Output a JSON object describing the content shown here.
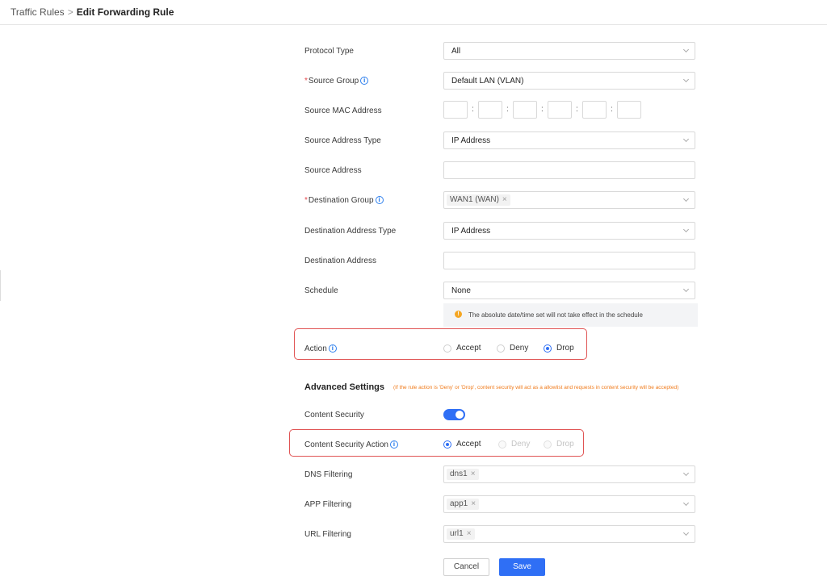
{
  "breadcrumb": {
    "parent": "Traffic Rules",
    "separator": ">",
    "current": "Edit Forwarding Rule"
  },
  "form": {
    "protocol_type": {
      "label": "Protocol Type",
      "value": "All"
    },
    "source_group": {
      "label": "Source Group",
      "required": true,
      "value": "Default LAN (VLAN)"
    },
    "source_mac": {
      "label": "Source MAC Address",
      "segments": [
        "",
        "",
        "",
        "",
        "",
        ""
      ],
      "separator": ":"
    },
    "source_address_type": {
      "label": "Source Address Type",
      "value": "IP Address"
    },
    "source_address": {
      "label": "Source Address",
      "value": ""
    },
    "destination_group": {
      "label": "Destination Group",
      "required": true,
      "tags": [
        "WAN1 (WAN)"
      ]
    },
    "destination_address_type": {
      "label": "Destination Address Type",
      "value": "IP Address"
    },
    "destination_address": {
      "label": "Destination Address",
      "value": ""
    },
    "schedule": {
      "label": "Schedule",
      "value": "None",
      "notice": "The absolute date/time set will not take effect in the schedule"
    },
    "action": {
      "label": "Action",
      "options": [
        "Accept",
        "Deny",
        "Drop"
      ],
      "selected": "Drop"
    }
  },
  "advanced": {
    "title": "Advanced Settings",
    "note": "(If the rule action is 'Deny' or 'Drop', content security will act as a allowlist and requests in content security will be accepted)",
    "content_security": {
      "label": "Content Security",
      "enabled": true
    },
    "content_security_action": {
      "label": "Content Security Action",
      "options": [
        "Accept",
        "Deny",
        "Drop"
      ],
      "selected": "Accept",
      "disabled": [
        "Deny",
        "Drop"
      ]
    },
    "dns_filtering": {
      "label": "DNS Filtering",
      "tags": [
        "dns1"
      ]
    },
    "app_filtering": {
      "label": "APP Filtering",
      "tags": [
        "app1"
      ]
    },
    "url_filtering": {
      "label": "URL Filtering",
      "tags": [
        "url1"
      ]
    }
  },
  "buttons": {
    "cancel": "Cancel",
    "save": "Save"
  },
  "icons": {
    "info": "info-icon",
    "warning": "warning-icon",
    "chevron": "chevron-down-icon",
    "tag_remove": "close-icon"
  },
  "colors": {
    "primary": "#2f6ff5",
    "required": "#e5484d",
    "highlight": "#e05454",
    "note": "#f07a1a",
    "warning": "#f5a623"
  }
}
